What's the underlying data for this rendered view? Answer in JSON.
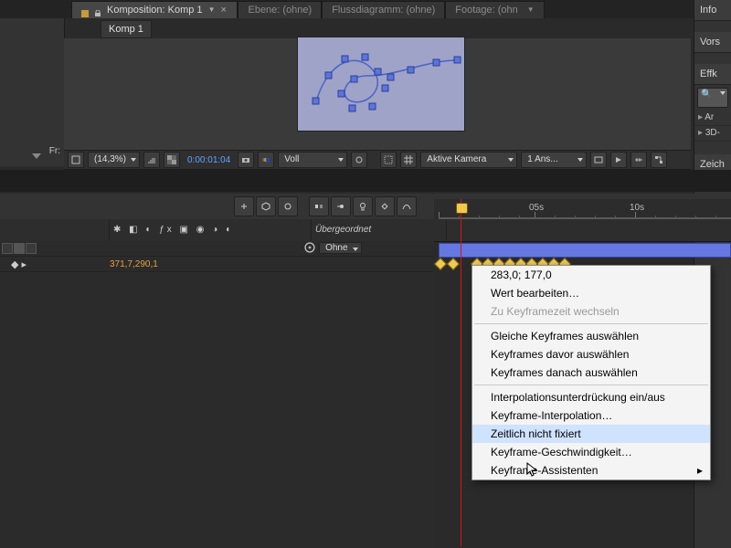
{
  "tabs": {
    "comp": "Komposition: Komp 1",
    "layer": "Ebene: (ohne)",
    "flow": "Flussdiagramm: (ohne)",
    "footage": "Footage: (ohn",
    "subcomp": "Komp 1"
  },
  "right_panel": {
    "info": "Info",
    "vors": "Vors",
    "effk": "Effk",
    "item1": "Ar",
    "item2": "3D-"
  },
  "zeich_tab": "Zeich",
  "leftgutter_label": "Fr:",
  "viewer": {
    "zoom": "(14,3%)",
    "timecode": "0:00:01:04",
    "alpha": "Voll",
    "camera": "Aktive Kamera",
    "views": "1 Ans..."
  },
  "ruler": {
    "t1": "05s",
    "t2": "10s"
  },
  "tl_header": {
    "parent_col": "Übergeordnet",
    "parent_value": "Ohne",
    "position_value": "371,7,290,1"
  },
  "context_menu": {
    "value": "283,0; 177,0",
    "edit": "Wert bearbeiten…",
    "gototime": "Zu Keyframezeit wechseln",
    "select_same": "Gleiche Keyframes auswählen",
    "select_before": "Keyframes davor auswählen",
    "select_after": "Keyframes danach auswählen",
    "interp_toggle": "Interpolationsunterdrückung ein/aus",
    "interp": "Keyframe-Interpolation…",
    "rove": "Zeitlich nicht fixiert",
    "velocity": "Keyframe-Geschwindigkeit…",
    "assistants": "Keyframe-Assistenten"
  }
}
